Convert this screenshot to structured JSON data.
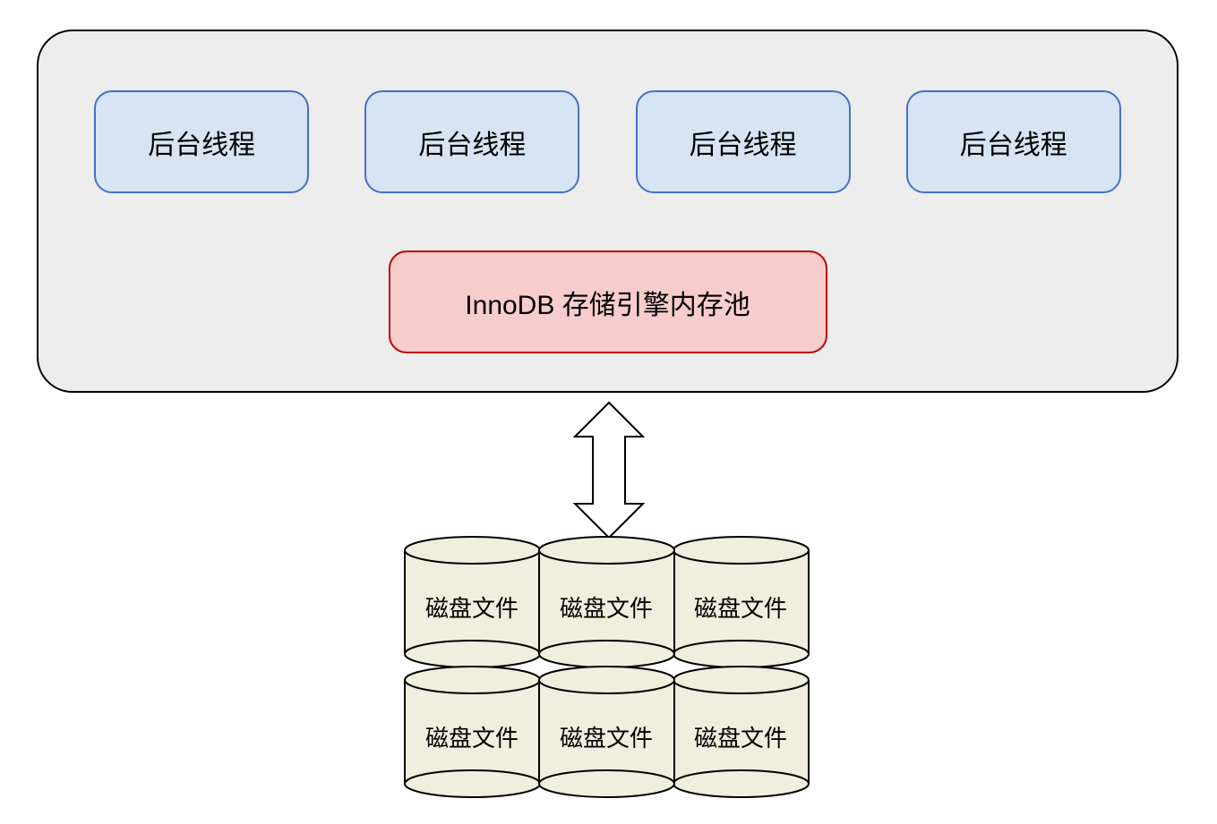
{
  "container": {
    "threads": [
      {
        "label": "后台线程"
      },
      {
        "label": "后台线程"
      },
      {
        "label": "后台线程"
      },
      {
        "label": "后台线程"
      }
    ],
    "memory_pool_label": "InnoDB 存储引擎内存池"
  },
  "disks": [
    {
      "label": "磁盘文件"
    },
    {
      "label": "磁盘文件"
    },
    {
      "label": "磁盘文件"
    },
    {
      "label": "磁盘文件"
    },
    {
      "label": "磁盘文件"
    },
    {
      "label": "磁盘文件"
    }
  ],
  "colors": {
    "thread_fill": "#d6e4f3",
    "thread_border": "#4471c4",
    "memory_fill": "#f7cdcc",
    "memory_border": "#c00000",
    "container_fill": "#ededed",
    "disk_fill": "#f0eedc"
  }
}
